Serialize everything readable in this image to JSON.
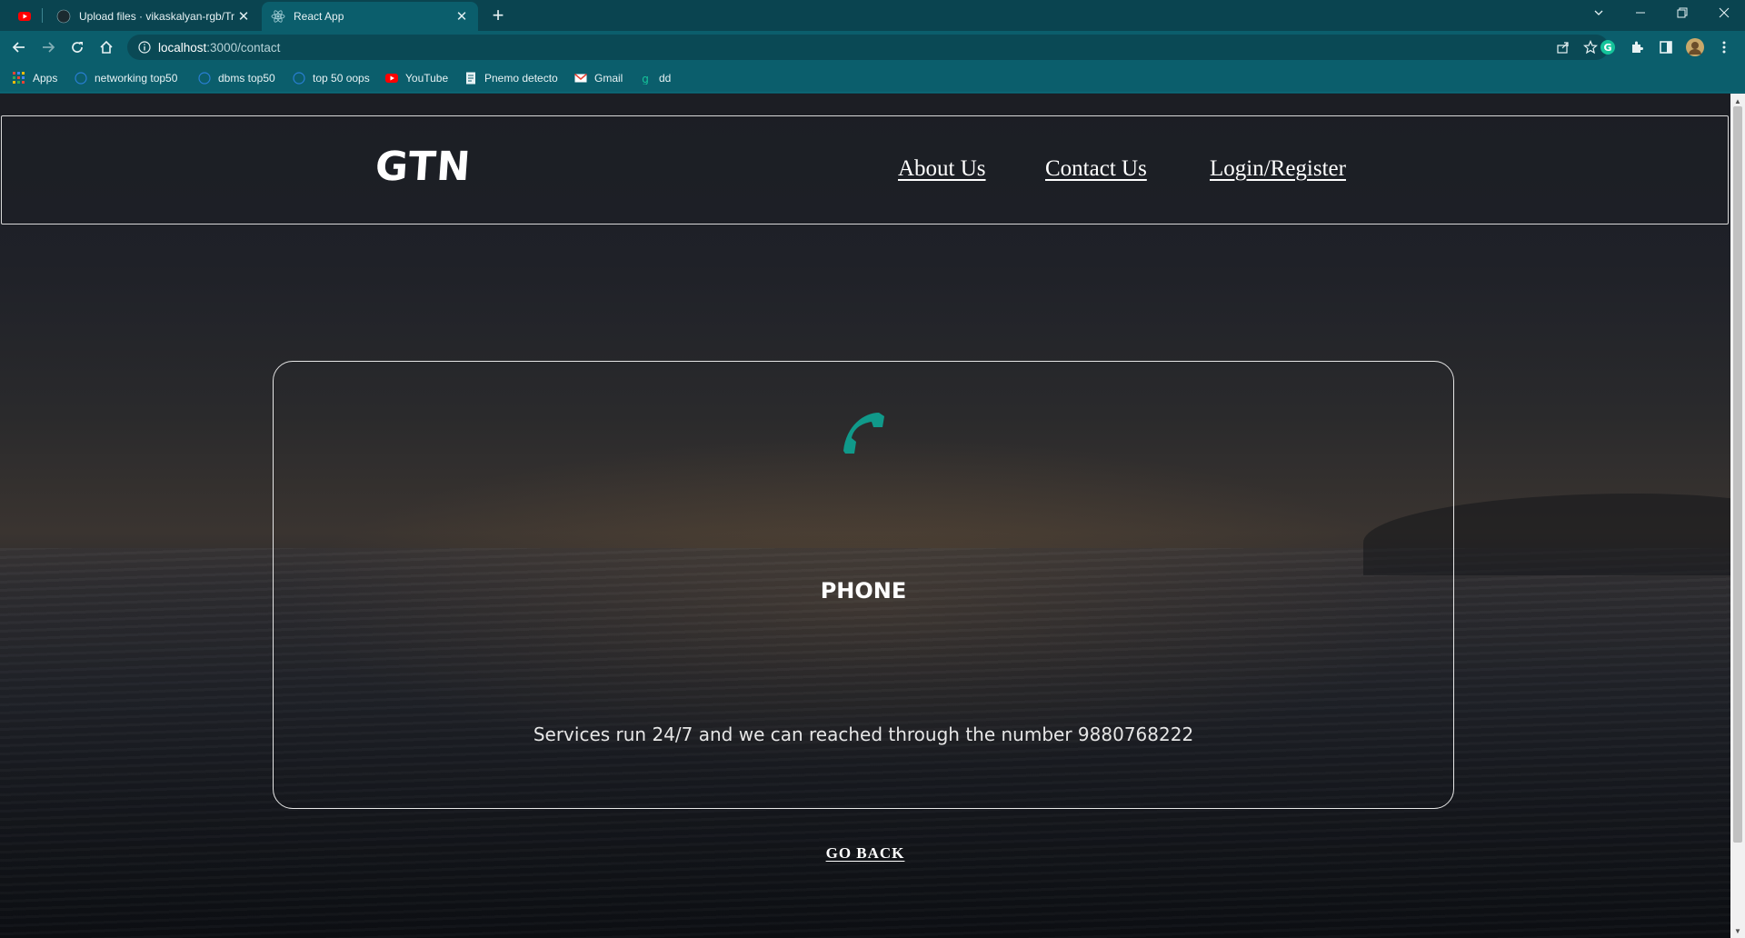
{
  "browser": {
    "tabs": [
      {
        "title": "",
        "icon": "youtube-icon"
      },
      {
        "title": "Upload files · vikaskalyan-rgb/Tra",
        "icon": "github-icon"
      },
      {
        "title": "React App",
        "icon": "react-icon",
        "active": true
      }
    ],
    "url_host": "localhost",
    "url_path": ":3000/contact",
    "bookmarks": [
      {
        "label": "Apps",
        "icon": "apps-grid-icon"
      },
      {
        "label": "networking top50",
        "icon": "globe-icon"
      },
      {
        "label": "dbms top50",
        "icon": "globe-icon"
      },
      {
        "label": "top 50 oops",
        "icon": "globe-icon"
      },
      {
        "label": "YouTube",
        "icon": "youtube-icon"
      },
      {
        "label": "Pnemo detecto",
        "icon": "document-icon"
      },
      {
        "label": "Gmail",
        "icon": "gmail-icon"
      },
      {
        "label": "dd",
        "icon": "grammarly-icon"
      }
    ],
    "accent_color": "#0b5e6c"
  },
  "site": {
    "logo": "GTN",
    "nav": {
      "about": "About Us",
      "contact": "Contact Us",
      "login": "Login/Register"
    }
  },
  "contact_card": {
    "icon": "phone-icon",
    "icon_color": "#10998a",
    "title": "PHONE",
    "text": "Services run 24/7 and we can reached through the number 9880768222"
  },
  "go_back": "GO BACK"
}
